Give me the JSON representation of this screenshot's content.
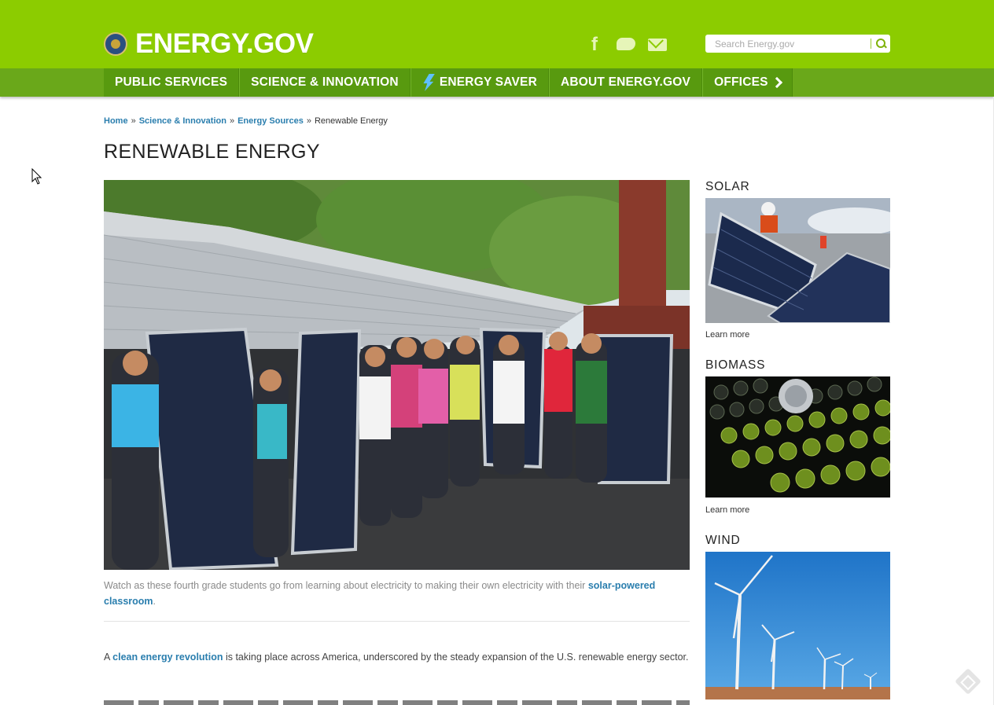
{
  "header": {
    "logo_text": "ENERGY.GOV",
    "search_placeholder": "Search Energy.gov",
    "bg_color": "#8ccc00",
    "icons": [
      "facebook-icon",
      "twitter-icon",
      "email-icon",
      "search-icon"
    ]
  },
  "nav": {
    "items": [
      {
        "label": "PUBLIC SERVICES"
      },
      {
        "label": "SCIENCE & INNOVATION"
      },
      {
        "label": "ENERGY SAVER",
        "icon": "lightning-bolt-icon"
      },
      {
        "label": "ABOUT ENERGY.GOV"
      },
      {
        "label": "OFFICES",
        "icon": "chevron-right-icon"
      }
    ]
  },
  "breadcrumb": {
    "items": [
      "Home",
      "Science & Innovation",
      "Energy Sources"
    ],
    "current": "Renewable Energy",
    "separator": "»"
  },
  "page": {
    "title": "RENEWABLE ENERGY",
    "hero_caption_prefix": "Watch as these fourth grade students go from learning about electricity to making their own electricity with their",
    "hero_caption_link": "solar-powered classroom",
    "hero_caption_suffix": ".",
    "intro_prefix": "A",
    "intro_link": "clean energy revolution",
    "intro_suffix": "is taking place across America, underscored by the steady expansion of the U.S. renewable energy sector."
  },
  "sidebar": {
    "sections": [
      {
        "title": "SOLAR",
        "link": "Learn more"
      },
      {
        "title": "BIOMASS",
        "link": "Learn more"
      },
      {
        "title": "WIND"
      }
    ]
  },
  "colors": {
    "brand_green": "#8ccc00",
    "nav_green": "#589a0f",
    "link_blue": "#2a7eae"
  }
}
